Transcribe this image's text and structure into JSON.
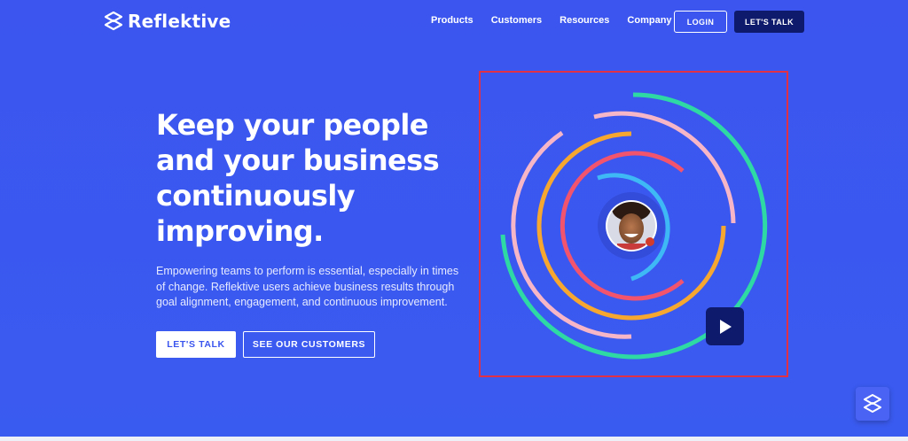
{
  "header": {
    "brand": "Reflektive",
    "nav": [
      "Products",
      "Customers",
      "Resources",
      "Company"
    ],
    "login_label": "LOGIN",
    "talk_label": "LET'S TALK"
  },
  "hero": {
    "headline_lines": [
      "Keep your people",
      "and your business",
      "continuously",
      "improving."
    ],
    "subtext_lines": [
      "Empowering teams to perform is essential, especially in times",
      "of change. Reflektive users achieve business results through",
      "goal alignment, engagement, and continuous improvement."
    ],
    "primary_cta": "LET'S TALK",
    "secondary_cta": "SEE OUR CUSTOMERS"
  },
  "video": {
    "icons": [
      "play-icon",
      "avatar-photo"
    ],
    "ring_colors": [
      "#2fd9a3",
      "#f6b6c8",
      "#f6a730",
      "#f2546e",
      "#3fb8f6"
    ]
  },
  "widget": {
    "icon": "reflektive-logo-icon"
  },
  "colors": {
    "background": "#3b55ee",
    "dark_button": "#0e1a6b",
    "frame_border": "#e03244"
  }
}
